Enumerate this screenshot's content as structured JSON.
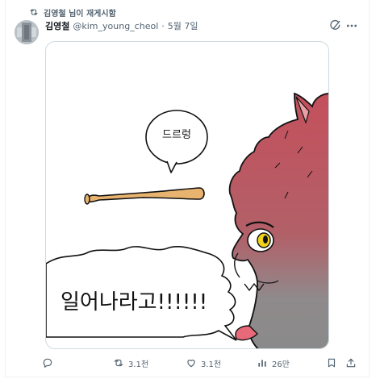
{
  "repost": {
    "label": "김영철 님이 재게시함",
    "icon": "repost-icon"
  },
  "author": {
    "name": "김영철",
    "handle": "@kim_young_cheol",
    "separator": "·",
    "date": "5월 7일"
  },
  "header_icons": {
    "grok": "grok-icon",
    "more": "more-icon"
  },
  "media": {
    "bubble_text": "드르렁",
    "shout_text": "일어나라고!!!!!!",
    "colors": {
      "bat": "#e8b36f",
      "creature_top": "#c4505c",
      "creature_bottom": "#8a8a8a",
      "eye": "#f1d21c"
    }
  },
  "actions": {
    "reply": {
      "icon": "reply-icon",
      "count": ""
    },
    "repost": {
      "icon": "repost-icon",
      "count": "3.1천"
    },
    "like": {
      "icon": "heart-icon",
      "count": "3.1천"
    },
    "views": {
      "icon": "views-icon",
      "count": "26만"
    },
    "bookmark": {
      "icon": "bookmark-icon"
    },
    "share": {
      "icon": "share-icon"
    }
  }
}
